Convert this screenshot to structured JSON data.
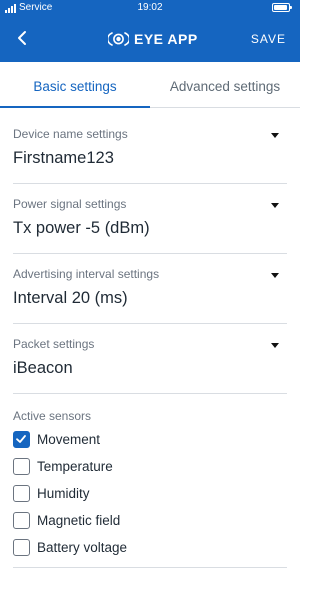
{
  "status_bar": {
    "carrier": "Service",
    "time": "19:02"
  },
  "header": {
    "title": "EYE APP",
    "save_label": "SAVE"
  },
  "tabs": [
    {
      "label": "Basic settings",
      "active": true
    },
    {
      "label": "Advanced settings",
      "active": false
    }
  ],
  "settings": [
    {
      "label": "Device name settings",
      "value": "Firstname123"
    },
    {
      "label": "Power signal settings",
      "value": "Tx power -5 (dBm)"
    },
    {
      "label": "Advertising interval settings",
      "value": "Interval 20 (ms)"
    },
    {
      "label": "Packet settings",
      "value": "iBeacon"
    }
  ],
  "sensors": {
    "label": "Active sensors",
    "items": [
      {
        "label": "Movement",
        "checked": true
      },
      {
        "label": "Temperature",
        "checked": false
      },
      {
        "label": "Humidity",
        "checked": false
      },
      {
        "label": "Magnetic field",
        "checked": false
      },
      {
        "label": "Battery voltage",
        "checked": false
      }
    ]
  },
  "colors": {
    "accent": "#1565c0",
    "text": "#1f2a35",
    "muted": "#6b7480",
    "divider": "#d9dde2"
  },
  "icons": {
    "back": "chevron-left-icon",
    "logo": "eye-logo-icon",
    "signal": "signal-bars-icon",
    "battery": "battery-icon",
    "dropdown": "triangle-down-icon",
    "check": "checkmark-icon"
  }
}
